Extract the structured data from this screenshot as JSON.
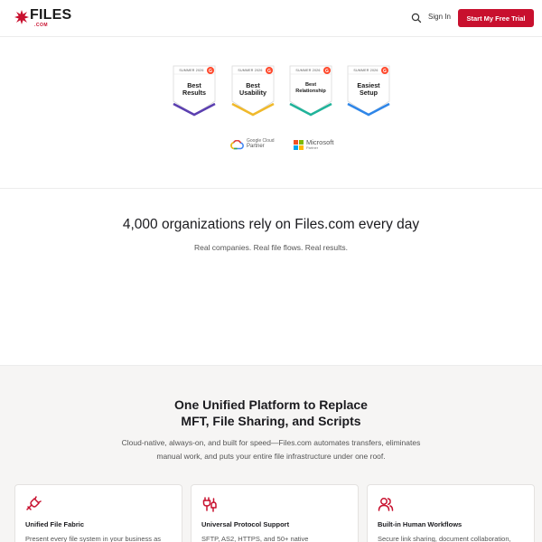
{
  "header": {
    "logo_word": "FILES",
    "logo_sub": ".COM",
    "signin": "Sign In",
    "trial": "Start My Free Trial"
  },
  "badges": [
    {
      "season": "SUMMER 2026",
      "line1": "Best",
      "line2": "Results",
      "color": "#5b3fb0"
    },
    {
      "season": "SUMMER 2026",
      "line1": "Best",
      "line2": "Usability",
      "color": "#f0b92b"
    },
    {
      "season": "SUMMER 2026",
      "line1": "Best",
      "line2": "Relationship",
      "color": "#20b39a"
    },
    {
      "season": "SUMMER 2026",
      "line1": "Easiest",
      "line2": "Setup",
      "color": "#2f86e8"
    }
  ],
  "partners": {
    "google_line1": "Google Cloud",
    "google_line2": "Partner",
    "ms_line1": "Microsoft",
    "ms_line2": "Partner"
  },
  "social_proof": {
    "headline": "4,000 organizations rely on Files.com every day",
    "subline": "Real companies. Real file flows. Real results."
  },
  "platform": {
    "title_line1": "One Unified Platform to Replace",
    "title_line2": "MFT, File Sharing, and Scripts",
    "desc_line1": "Cloud-native, always-on, and built for speed—Files.com automates transfers, eliminates",
    "desc_line2": "manual work, and puts your entire file infrastructure under one roof.",
    "cards": [
      {
        "title": "Unified File Fabric",
        "text": "Present every file system in your business as"
      },
      {
        "title": "Universal Protocol Support",
        "text": "SFTP, AS2, HTTPS, and 50+ native"
      },
      {
        "title": "Built-in Human Workflows",
        "text": "Secure link sharing, document collaboration,"
      }
    ]
  },
  "colors": {
    "brand": "#c8102e",
    "g2_red": "#ff492c"
  }
}
